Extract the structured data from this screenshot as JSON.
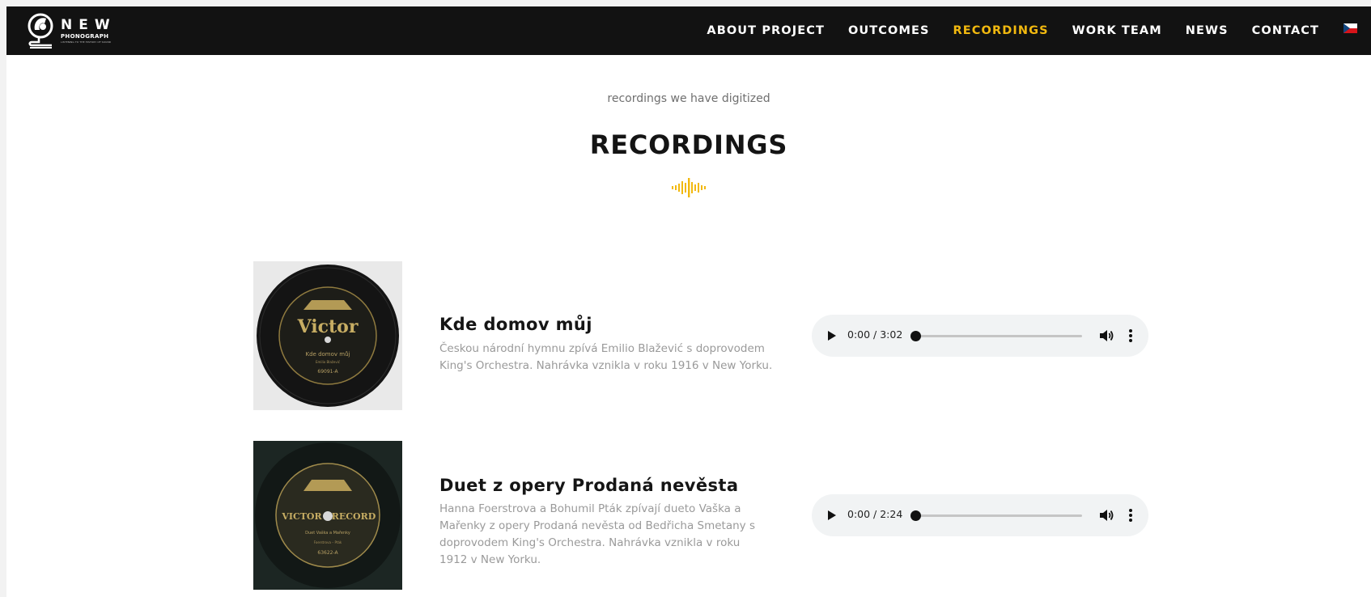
{
  "header": {
    "logo": {
      "word": "NEW",
      "sub": "PHONOGRAPH",
      "tagline": "LISTENING TO THE HISTORY OF SOUND"
    },
    "nav": [
      {
        "label": "ABOUT PROJECT",
        "active": false
      },
      {
        "label": "OUTCOMES",
        "active": false
      },
      {
        "label": "RECORDINGS",
        "active": true
      },
      {
        "label": "WORK TEAM",
        "active": false
      },
      {
        "label": "NEWS",
        "active": false
      },
      {
        "label": "CONTACT",
        "active": false
      }
    ],
    "language_flag": "czech-flag-icon"
  },
  "hero": {
    "kicker": "recordings we have digitized",
    "title": "RECORDINGS",
    "divider_icon": "sound-wave-icon"
  },
  "recordings": [
    {
      "title": "Kde domov můj",
      "description": "Českou národní hymnu zpívá Emilio Blažević s doprovodem King's Orchestra. Nahrávka vznikla v roku 1916 v New Yorku.",
      "cover_icon": "victor-record-icon",
      "player": {
        "time": "0:00 / 3:02",
        "progress": 0
      }
    },
    {
      "title": "Duet z opery Prodaná nevěsta",
      "description": "Hanna Foerstrova a Bohumil Pták zpívají dueto Vaška a Mařenky z opery Prodaná nevěsta od Bedřicha Smetany s doprovodem King's Orchestra. Nahrávka vznikla v roku 1912 v New Yorku.",
      "cover_icon": "victor-record-icon",
      "player": {
        "time": "0:00 / 2:24",
        "progress": 0
      }
    }
  ],
  "colors": {
    "header_bg": "#121212",
    "accent": "#f2b90f",
    "heading": "#141414",
    "muted_text": "#9a9a9a",
    "player_bg": "#f1f3f4"
  }
}
